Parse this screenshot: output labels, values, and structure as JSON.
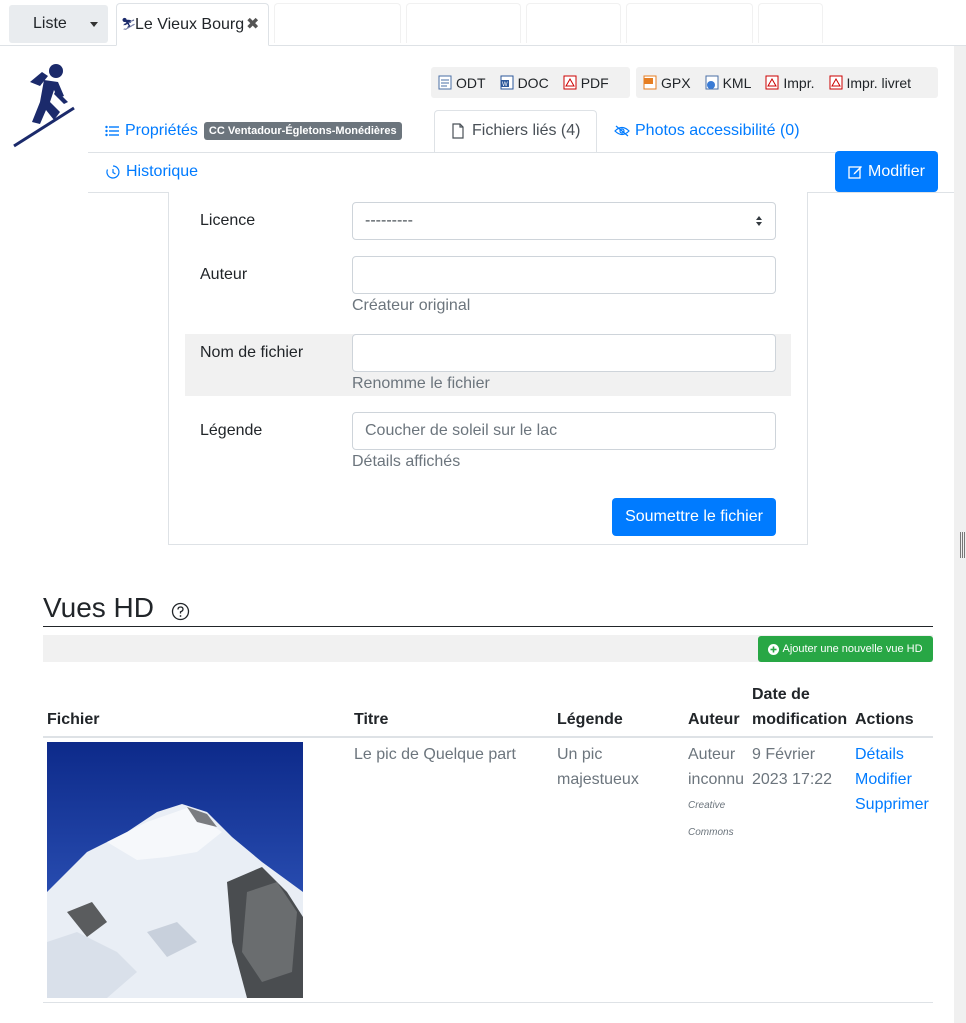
{
  "topbar": {
    "liste_label": "Liste",
    "object_tab_label": "Le Vieux Bourg",
    "close_glyph": "✖"
  },
  "exports": {
    "group1": [
      {
        "label": "ODT",
        "icon": "odt-file-icon"
      },
      {
        "label": "DOC",
        "icon": "doc-file-icon"
      },
      {
        "label": "PDF",
        "icon": "pdf-file-icon"
      }
    ],
    "group2": [
      {
        "label": "GPX",
        "icon": "gpx-file-icon"
      },
      {
        "label": "KML",
        "icon": "kml-file-icon"
      },
      {
        "label": "Impr.",
        "icon": "print-pdf-icon"
      },
      {
        "label": "Impr. livret",
        "icon": "print-booklet-icon"
      }
    ]
  },
  "tabs": {
    "properties": "Propriétés",
    "properties_badge": "CC Ventadour-Égletons-Monédières",
    "files": "Fichiers liés (4)",
    "accessibility": "Photos accessibilité (0)",
    "history": "Historique",
    "modify": "Modifier"
  },
  "form": {
    "licence_label": "Licence",
    "licence_value": "---------",
    "author_label": "Auteur",
    "author_value": "",
    "author_help": "Créateur original",
    "filename_label": "Nom de fichier",
    "filename_value": "",
    "filename_help": "Renomme le fichier",
    "legend_label": "Légende",
    "legend_placeholder": "Coucher de soleil sur le lac",
    "legend_help": "Détails affichés",
    "submit": "Soumettre le fichier"
  },
  "hd": {
    "title": "Vues HD",
    "add_button": "Ajouter une nouvelle vue HD",
    "columns": {
      "file": "Fichier",
      "title": "Titre",
      "legend": "Légende",
      "author": "Auteur",
      "date_line1": "Date de",
      "date_line2": "modification",
      "actions": "Actions"
    },
    "rows": [
      {
        "title": "Le pic de Quelque part",
        "legend_line1": "Un pic",
        "legend_line2": "majestueux",
        "author_line1": "Auteur",
        "author_line2": "inconnu",
        "license_line1": "Creative",
        "license_line2": "Commons",
        "date_line1": "9 Février",
        "date_line2": "2023 17:22",
        "action_details": "Détails",
        "action_modify": "Modifier",
        "action_delete": "Supprimer"
      }
    ]
  },
  "colors": {
    "primary": "#007bff",
    "success": "#28a745",
    "badge": "#6c757d",
    "logo": "#1b2a6b"
  }
}
